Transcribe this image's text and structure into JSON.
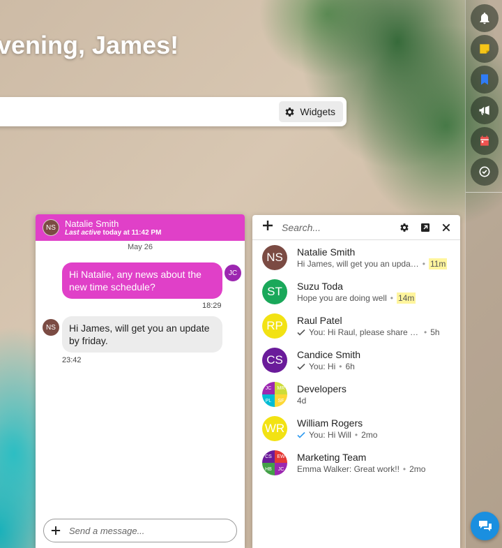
{
  "greeting": "vening, James!",
  "search_bar": {
    "widgets_label": "Widgets"
  },
  "rail": [
    {
      "icon": "bell-icon",
      "color": "#ffffff"
    },
    {
      "icon": "note-icon",
      "color": "#f5c518"
    },
    {
      "icon": "bookmark-icon",
      "color": "#2f7cf6"
    },
    {
      "icon": "megaphone-icon",
      "color": "#ffffff"
    },
    {
      "icon": "calendar-icon",
      "color": "#ef5350"
    },
    {
      "icon": "clock-icon",
      "color": "#ffffff"
    }
  ],
  "chat": {
    "contact_initials": "NS",
    "contact_name": "Natalie Smith",
    "last_active_label": "Last active",
    "last_active_time": "today at 11:42 PM",
    "date": "May 26",
    "messages": [
      {
        "direction": "out",
        "text": "Hi Natalie, any news about the new time schedule?",
        "time": "18:29",
        "avatar": "JC"
      },
      {
        "direction": "in",
        "text": "Hi James, will get you an update by friday.",
        "time": "23:42",
        "avatar": "NS"
      }
    ],
    "input_placeholder": "Send a message...",
    "accent_color": "#e040c8"
  },
  "contacts": {
    "search_placeholder": "Search...",
    "items": [
      {
        "initials": "NS",
        "color": "#7b4b43",
        "name": "Natalie Smith",
        "preview": "Hi James, will get you an upda…",
        "time": "11m",
        "highlight": true
      },
      {
        "initials": "ST",
        "color": "#1aa85a",
        "name": "Suzu Toda",
        "preview": "Hope you are doing well",
        "time": "14m",
        "highlight": true
      },
      {
        "initials": "RP",
        "color": "#f2e213",
        "name": "Raul Patel",
        "preview": "You: Hi Raul, please share t…",
        "time": "5h",
        "check": "grey"
      },
      {
        "initials": "CS",
        "color": "#6a1b9a",
        "name": "Candice Smith",
        "preview": "You: Hi",
        "time": "6h",
        "check": "grey"
      },
      {
        "group": true,
        "name": "Developers",
        "preview": "",
        "time": "4d",
        "tiles": [
          {
            "t": "JC",
            "c": "#9c27b0"
          },
          {
            "t": "MR",
            "c": "#cddc39"
          },
          {
            "t": "PL",
            "c": "#00bcd4"
          },
          {
            "t": "SF",
            "c": "#fdd835"
          }
        ]
      },
      {
        "initials": "WR",
        "color": "#f2e213",
        "name": "William Rogers",
        "preview": "You: Hi Will",
        "time": "2mo",
        "check": "blue"
      },
      {
        "group": true,
        "name": "Marketing Team",
        "preview": "Emma Walker: Great work!!",
        "time": "2mo",
        "tiles": [
          {
            "t": "CS",
            "c": "#6a1b9a"
          },
          {
            "t": "EW",
            "c": "#e53935"
          },
          {
            "t": "HB",
            "c": "#43a047"
          },
          {
            "t": "JC",
            "c": "#9c27b0"
          }
        ]
      }
    ]
  }
}
